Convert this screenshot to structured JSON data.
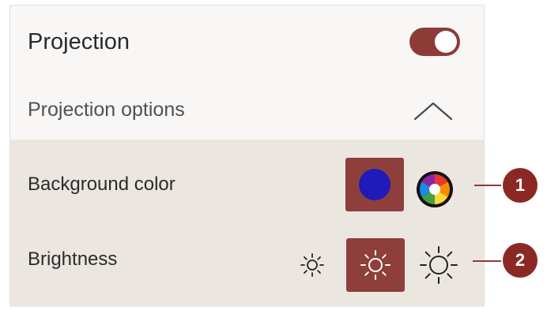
{
  "projection": {
    "label": "Projection",
    "toggle_on": true,
    "toggle_color": "#8e3b38"
  },
  "projection_options": {
    "label": "Projection options",
    "expanded": true,
    "chevron_icon": "chevron-up-icon"
  },
  "background_color": {
    "label": "Background color",
    "selected_color": "#1f1bb8",
    "picker_icon": "color-wheel-icon"
  },
  "brightness": {
    "label": "Brightness",
    "levels": [
      "low",
      "medium",
      "high"
    ],
    "selected_level": "medium",
    "icon": "sun-icon"
  },
  "callouts": [
    {
      "number": "1"
    },
    {
      "number": "2"
    }
  ],
  "colors": {
    "accent": "#8e3b38",
    "selected_bg": "#8e3f3c",
    "badge": "#8c2823",
    "submenu_bg": "#ece6e1"
  }
}
